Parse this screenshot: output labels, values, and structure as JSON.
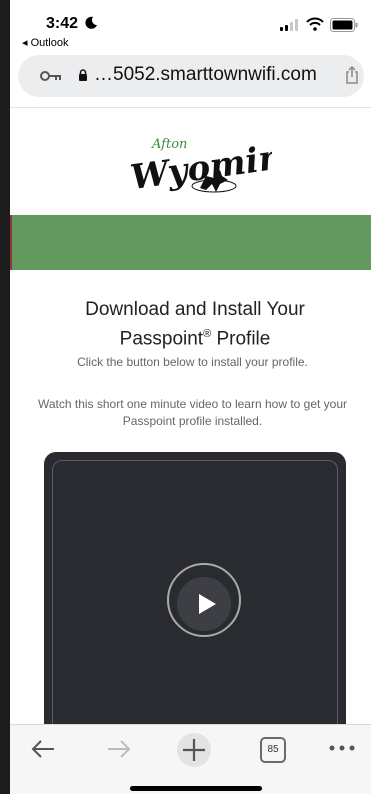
{
  "status_bar": {
    "time": "3:42",
    "back_app": "◂ Outlook"
  },
  "browser": {
    "url": "…5052.smarttownwifi.com",
    "tab_count": "85"
  },
  "logo": {
    "script_small": "Afton",
    "script_large": "Wyoming"
  },
  "content": {
    "heading_line1": "Download and Install Your",
    "heading_line2_pre": "Passpoint",
    "heading_line2_sup": "®",
    "heading_line2_post": " Profile",
    "instruction": "Click the button below to install your profile.",
    "video_note": "Watch this short one minute video to learn how to get your Passpoint profile installed."
  },
  "colors": {
    "banner_green": "#63995e",
    "video_bg": "#2a2b31"
  },
  "icons": [
    "moon-icon",
    "signal-icon",
    "wifi-icon",
    "battery-icon",
    "key-icon",
    "lock-icon",
    "share-icon",
    "play-icon",
    "back-arrow-icon",
    "forward-arrow-icon",
    "plus-icon",
    "tabs-icon",
    "more-icon"
  ]
}
